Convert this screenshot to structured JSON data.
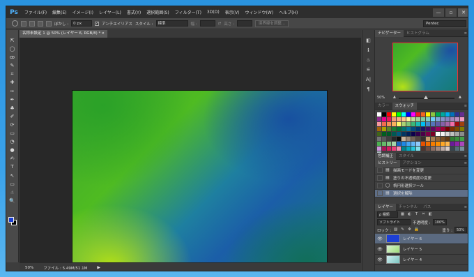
{
  "app": {
    "logo": "Ps"
  },
  "menu": [
    "ファイル(F)",
    "編集(E)",
    "イメージ(I)",
    "レイヤー(L)",
    "書式(Y)",
    "選択範囲(S)",
    "フィルター(T)",
    "3D(D)",
    "表示(V)",
    "ウィンドウ(W)",
    "ヘルプ(H)"
  ],
  "window_controls": {
    "minimize": "—",
    "restore": "▫",
    "close": "✕"
  },
  "options": {
    "feather_label": "ぼかし :",
    "feather_value": "0 px",
    "antialias_label": "アンチエイリアス",
    "style_label": "スタイル :",
    "style_value": "標準",
    "width_label": "幅 :",
    "height_label": "高さ :",
    "refine_button": "境界線を調整...",
    "workspace": "Pentec"
  },
  "document": {
    "tab_title": "名称未設定 1 @ 50% (レイヤー 6, RGB/8) *",
    "tab_close": "×"
  },
  "status": {
    "zoom": "50%",
    "file_info": "ファイル : 5.49M/51.1M",
    "arrow": "▶"
  },
  "tools": [
    "⇱",
    "◯",
    "ꝏ",
    "✎",
    "⌗",
    "✚",
    "✑",
    "✒",
    "♣",
    "✐",
    "⟳",
    "▭",
    "◔",
    "●",
    "✍",
    "T",
    "↖",
    "▭",
    "☝",
    "🔍"
  ],
  "tool_names": [
    "move-tool-icon",
    "elliptical-marquee-icon",
    "lasso-icon",
    "quick-selection-icon",
    "crop-icon",
    "eyedropper-icon",
    "healing-brush-icon",
    "brush-icon",
    "clone-stamp-icon",
    "history-brush-icon",
    "eraser-icon",
    "gradient-icon",
    "blur-icon",
    "dodge-icon",
    "pen-icon",
    "type-icon",
    "path-selection-icon",
    "rectangle-shape-icon",
    "hand-icon",
    "zoom-icon"
  ],
  "strip_icons": [
    "◧",
    "ℹ",
    "♨",
    "⚟",
    "A|",
    "¶"
  ],
  "strip_names": [
    "history-strip-icon",
    "info-strip-icon",
    "brush-strip-icon",
    "tool-presets-strip-icon",
    "character-strip-icon",
    "paragraph-strip-icon"
  ],
  "navigator": {
    "tabs": [
      "ナビゲーター",
      "ヒストグラム"
    ],
    "zoom": "50%"
  },
  "swatches_panel": {
    "tabs": [
      "カラー",
      "スウォッチ"
    ]
  },
  "swatch_colors": [
    "#ffffff",
    "#000000",
    "#ff0000",
    "#ffff00",
    "#00ff00",
    "#00ffff",
    "#0000ff",
    "#ff00ff",
    "#ed1c24",
    "#f26522",
    "#fff200",
    "#8dc63f",
    "#00a651",
    "#00a99d",
    "#00aeef",
    "#0072bc",
    "#2e3192",
    "#662d91",
    "#92278f",
    "#ec008c",
    "#ed145b",
    "#f7977a",
    "#f9ad81",
    "#fdc68a",
    "#fff79a",
    "#c4df9b",
    "#a3d39c",
    "#82ca9d",
    "#7bcdc8",
    "#6ecff6",
    "#7ea7d8",
    "#8493ca",
    "#8882be",
    "#a187be",
    "#bc8dbf",
    "#f49ac2",
    "#f6989d",
    "#f26c4f",
    "#f68e56",
    "#fbaf5d",
    "#fff568",
    "#acd373",
    "#7cc576",
    "#3bb878",
    "#1abbb4",
    "#00bff3",
    "#438ccb",
    "#5574b9",
    "#605ca8",
    "#8560a8",
    "#a864a8",
    "#f06eaa",
    "#9e0b0f",
    "#a0410d",
    "#a36209",
    "#aba000",
    "#598527",
    "#1a7b30",
    "#007236",
    "#00746b",
    "#0076a3",
    "#004b80",
    "#003471",
    "#1b1464",
    "#440e62",
    "#630460",
    "#9e005d",
    "#9e0039",
    "#790000",
    "#7b2e00",
    "#7d4900",
    "#827b00",
    "#406618",
    "#005e20",
    "#005826",
    "#005952",
    "#005b7f",
    "#003663",
    "#002157",
    "#0d004c",
    "#32004b",
    "#4b0049",
    "#7b0046",
    "#7a0026",
    "#ffffff",
    "#f2f2f2",
    "#d9d9d9",
    "#bfbfbf",
    "#a6a6a6",
    "#8c8c8c",
    "#737373",
    "#595959",
    "#404040",
    "#262626",
    "#0d0d0d",
    "#c7b299",
    "#998675",
    "#736357",
    "#534741",
    "#362f2d",
    "#c69c6d",
    "#a67c52",
    "#8c6239",
    "#754c24",
    "#603913",
    "#2e7d32",
    "#388e3c",
    "#43a047",
    "#4caf50",
    "#66bb6a",
    "#81c784",
    "#a5d6a7",
    "#1565c0",
    "#1e88e5",
    "#42a5f5",
    "#64b5f6",
    "#90caf9",
    "#e65100",
    "#ef6c00",
    "#f57c00",
    "#fb8c00",
    "#ffa726",
    "#ffb74d",
    "#6a1b9a",
    "#8e24aa",
    "#ab47bc",
    "#ce93d8",
    "#ad1457",
    "#d81b60",
    "#ec407a",
    "#f48fb1",
    "#00838f",
    "#00acc1",
    "#26c6da",
    "#80deea",
    "#4e342e",
    "#6d4c41",
    "#8d6e63",
    "#a1887f",
    "#bcaaa4",
    "#d7ccc8",
    "#37474f",
    "#546e7a",
    "#78909c",
    "#b0bec5"
  ],
  "adjustments_tabs": [
    "色調補正",
    "スタイル"
  ],
  "history": {
    "tabs": [
      "ヒストリー",
      "アクション"
    ],
    "items": [
      {
        "label": "描画モードを変更",
        "icon": "▤"
      },
      {
        "label": "塗りの不透明度の変更",
        "icon": "▤"
      },
      {
        "label": "楕円形選択ツール",
        "icon": "◯"
      },
      {
        "label": "選択を解除",
        "icon": "▤"
      }
    ]
  },
  "layers": {
    "tabs": [
      "レイヤー",
      "チャンネル",
      "パス"
    ],
    "kind": "ρ 種類",
    "blend_mode": "ソフトライト",
    "opacity_label": "不透明度 :",
    "opacity_value": "100%",
    "lock_label": "ロック :",
    "fill_label": "塗り :",
    "fill_value": "50%",
    "items": [
      {
        "name": "レイヤー 6",
        "thumb": "blue"
      },
      {
        "name": "レイヤー 5",
        "thumb": "checker-green"
      },
      {
        "name": "レイヤー 4",
        "thumb": "checker-teal"
      }
    ]
  },
  "icons": {
    "eye": "👁",
    "menu": "≡",
    "chev": "▾",
    "check": "✓",
    "lock_icons": [
      "▨",
      "✎",
      "✥",
      "🔒"
    ],
    "filter_icons": [
      "▦",
      "◐",
      "T",
      "⌗",
      "◧"
    ],
    "footer_layers": [
      "⊖",
      "fx",
      "◘",
      "◑",
      "▭",
      "▢",
      "🗑"
    ],
    "footer_history": [
      "◙",
      "▢",
      "🗑"
    ],
    "footer_swatches": [
      "▢",
      "🗑"
    ]
  }
}
